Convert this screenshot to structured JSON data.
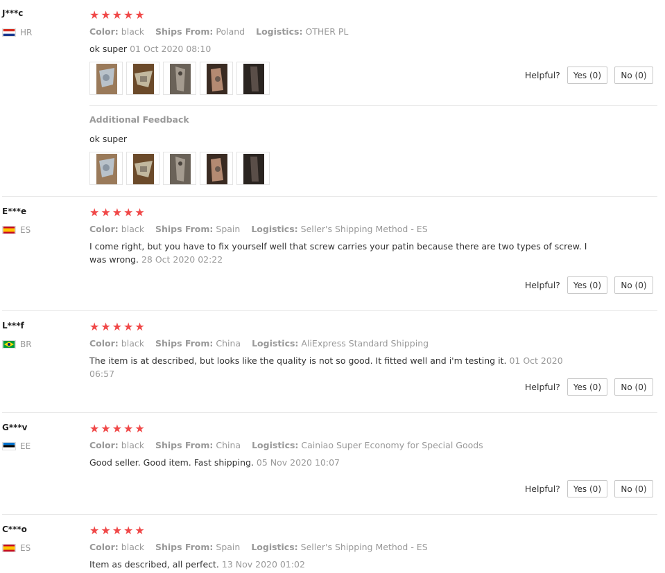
{
  "helpful_label": "Helpful?",
  "meta_labels": {
    "color": "Color:",
    "ships_from": "Ships From:",
    "logistics": "Logistics:"
  },
  "additional_feedback_label": "Additional Feedback",
  "colors": {
    "star": "#f04848",
    "muted": "#999999",
    "divider": "#e8e8e8"
  },
  "reviews": [
    {
      "user": "J***c",
      "country": "HR",
      "flag": "croatia-flag-icon",
      "rating": 5,
      "color": "black",
      "ships_from": "Poland",
      "logistics": "OTHER PL",
      "text": "ok super",
      "date": "01 Oct 2020 08:10",
      "yes": "Yes (0)",
      "no": "No (0)",
      "additional_text": "ok super"
    },
    {
      "user": "E***e",
      "country": "ES",
      "flag": "spain-flag-icon",
      "rating": 5,
      "color": "black",
      "ships_from": "Spain",
      "logistics": "Seller's Shipping Method - ES",
      "text": "I come right, but you have to fix yourself well that screw carries your patin because there are two types of screw. I was wrong.",
      "date": "28 Oct 2020 02:22",
      "yes": "Yes (0)",
      "no": "No (0)"
    },
    {
      "user": "L***f",
      "country": "BR",
      "flag": "brazil-flag-icon",
      "rating": 5,
      "color": "black",
      "ships_from": "China",
      "logistics": "AliExpress Standard Shipping",
      "text": "The item is at described, but looks like the quality is not so good. It fitted well and i'm testing it.",
      "date": "01 Oct 2020 06:57",
      "yes": "Yes (0)",
      "no": "No (0)"
    },
    {
      "user": "G***v",
      "country": "EE",
      "flag": "estonia-flag-icon",
      "rating": 5,
      "color": "black",
      "ships_from": "China",
      "logistics": "Cainiao Super Economy for Special Goods",
      "text": "Good seller. Good item. Fast shipping.",
      "date": "05 Nov 2020 10:07",
      "yes": "Yes (0)",
      "no": "No (0)"
    },
    {
      "user": "C***o",
      "country": "ES",
      "flag": "spain-flag-icon",
      "rating": 5,
      "color": "black",
      "ships_from": "Spain",
      "logistics": "Seller's Shipping Method - ES",
      "text": "Item as described, all perfect.",
      "date": "13 Nov 2020 01:02"
    }
  ]
}
